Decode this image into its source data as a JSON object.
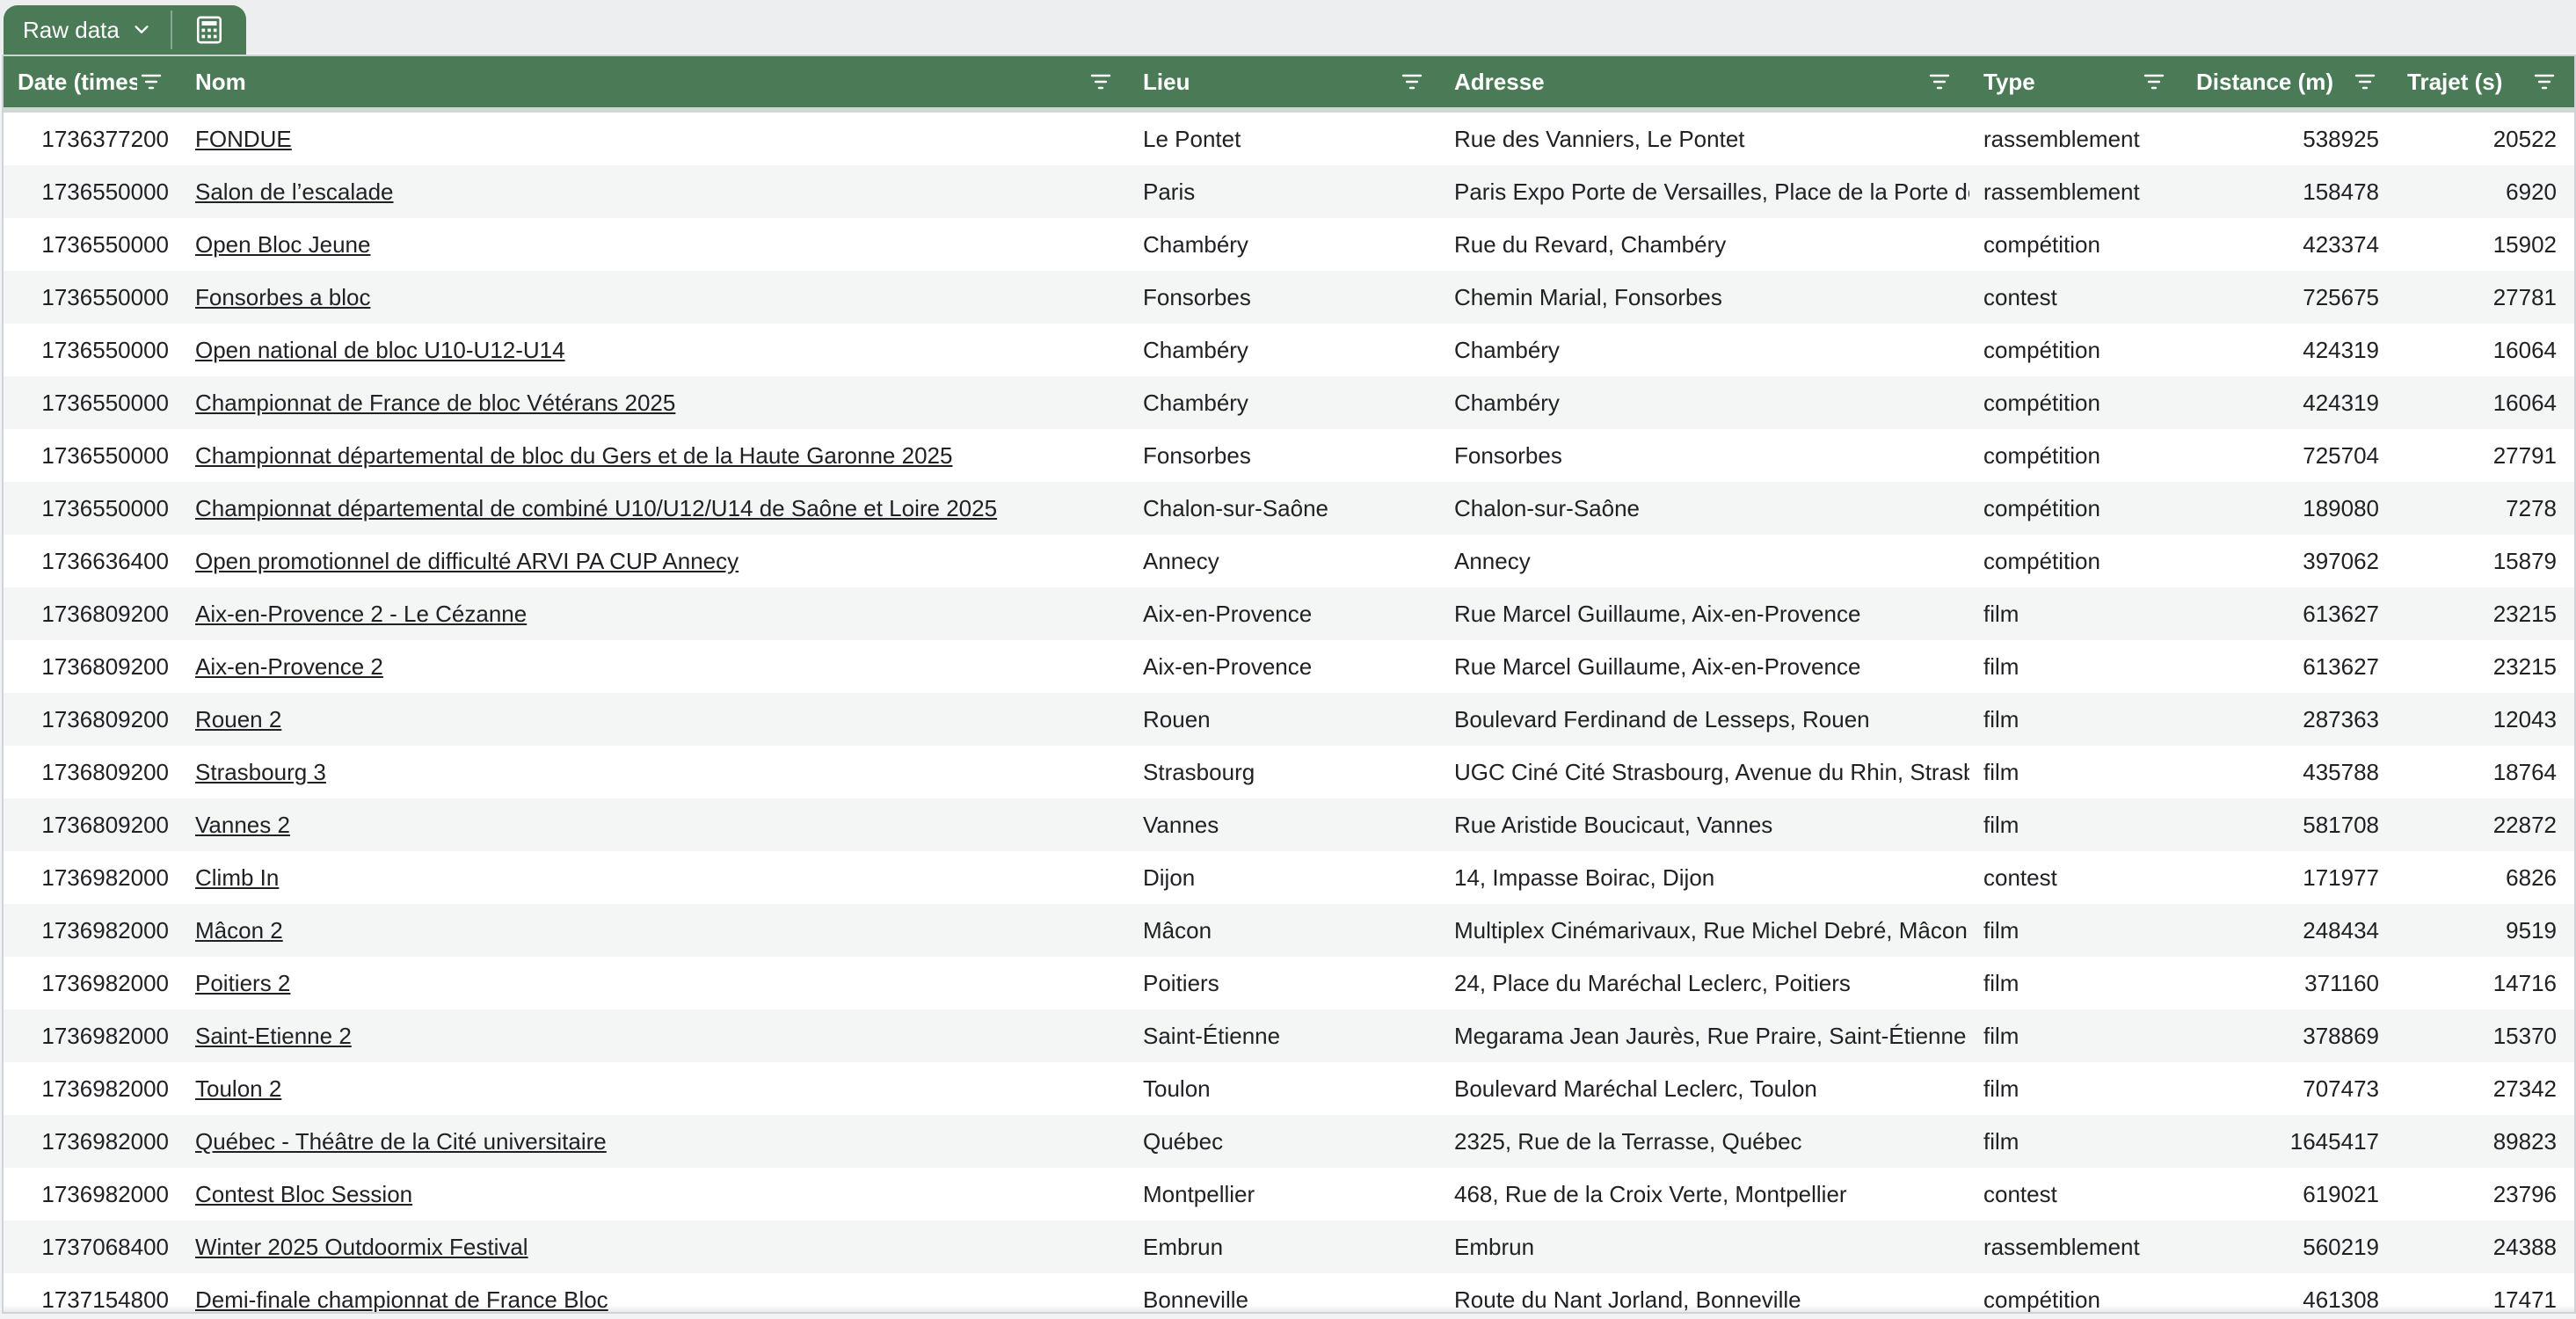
{
  "tabs": {
    "raw_label": "Raw data",
    "raw_icon": "chevron-down-icon",
    "calc_icon": "calculator-icon"
  },
  "columns": [
    {
      "label": "Date (timestamp)"
    },
    {
      "label": "Nom"
    },
    {
      "label": "Lieu"
    },
    {
      "label": "Adresse"
    },
    {
      "label": "Type"
    },
    {
      "label": "Distance (m)"
    },
    {
      "label": "Trajet (s)"
    }
  ],
  "rows": [
    {
      "date": "1736377200",
      "nom": "FONDUE",
      "lieu": "Le Pontet",
      "adresse": "Rue des Vanniers, Le Pontet",
      "type": "rassemblement",
      "distance": "538925",
      "trajet": "20522"
    },
    {
      "date": "1736550000",
      "nom": "Salon de l’escalade",
      "lieu": "Paris",
      "adresse": "Paris Expo Porte de Versailles, Place de la Porte de Versailles, Paris",
      "type": "rassemblement",
      "distance": "158478",
      "trajet": "6920"
    },
    {
      "date": "1736550000",
      "nom": "Open Bloc Jeune",
      "lieu": "Chambéry",
      "adresse": "Rue du Revard, Chambéry",
      "type": "compétition",
      "distance": "423374",
      "trajet": "15902"
    },
    {
      "date": "1736550000",
      "nom": "Fonsorbes a bloc",
      "lieu": "Fonsorbes",
      "adresse": "Chemin Marial, Fonsorbes",
      "type": "contest",
      "distance": "725675",
      "trajet": "27781"
    },
    {
      "date": "1736550000",
      "nom": "Open national de bloc U10-U12-U14",
      "lieu": "Chambéry",
      "adresse": "Chambéry",
      "type": "compétition",
      "distance": "424319",
      "trajet": "16064"
    },
    {
      "date": "1736550000",
      "nom": "Championnat de France de bloc Vétérans 2025",
      "lieu": "Chambéry",
      "adresse": "Chambéry",
      "type": "compétition",
      "distance": "424319",
      "trajet": "16064"
    },
    {
      "date": "1736550000",
      "nom": "Championnat départemental de bloc du Gers et de la Haute Garonne 2025",
      "lieu": "Fonsorbes",
      "adresse": "Fonsorbes",
      "type": "compétition",
      "distance": "725704",
      "trajet": "27791"
    },
    {
      "date": "1736550000",
      "nom": "Championnat départemental de combiné U10/U12/U14 de Saône et Loire 2025",
      "lieu": "Chalon-sur-Saône",
      "adresse": "Chalon-sur-Saône",
      "type": "compétition",
      "distance": "189080",
      "trajet": "7278"
    },
    {
      "date": "1736636400",
      "nom": "Open promotionnel de difficulté ARVI PA CUP Annecy",
      "lieu": "Annecy",
      "adresse": "Annecy",
      "type": "compétition",
      "distance": "397062",
      "trajet": "15879"
    },
    {
      "date": "1736809200",
      "nom": "Aix-en-Provence 2 - Le Cézanne",
      "lieu": "Aix-en-Provence",
      "adresse": "Rue Marcel Guillaume, Aix-en-Provence",
      "type": "film",
      "distance": "613627",
      "trajet": "23215"
    },
    {
      "date": "1736809200",
      "nom": "Aix-en-Provence 2",
      "lieu": "Aix-en-Provence",
      "adresse": "Rue Marcel Guillaume, Aix-en-Provence",
      "type": "film",
      "distance": "613627",
      "trajet": "23215"
    },
    {
      "date": "1736809200",
      "nom": "Rouen 2",
      "lieu": "Rouen",
      "adresse": "Boulevard Ferdinand de Lesseps, Rouen",
      "type": "film",
      "distance": "287363",
      "trajet": "12043"
    },
    {
      "date": "1736809200",
      "nom": "Strasbourg 3",
      "lieu": "Strasbourg",
      "adresse": "UGC Ciné Cité Strasbourg, Avenue du Rhin, Strasbourg",
      "type": "film",
      "distance": "435788",
      "trajet": "18764"
    },
    {
      "date": "1736809200",
      "nom": "Vannes 2",
      "lieu": "Vannes",
      "adresse": "Rue Aristide Boucicaut, Vannes",
      "type": "film",
      "distance": "581708",
      "trajet": "22872"
    },
    {
      "date": "1736982000",
      "nom": "Climb In",
      "lieu": "Dijon",
      "adresse": "14, Impasse Boirac, Dijon",
      "type": "contest",
      "distance": "171977",
      "trajet": "6826"
    },
    {
      "date": "1736982000",
      "nom": "Mâcon 2",
      "lieu": "Mâcon",
      "adresse": "Multiplex Cinémarivaux, Rue Michel Debré, Mâcon",
      "type": "film",
      "distance": "248434",
      "trajet": "9519"
    },
    {
      "date": "1736982000",
      "nom": "Poitiers 2",
      "lieu": "Poitiers",
      "adresse": "24, Place du Maréchal Leclerc, Poitiers",
      "type": "film",
      "distance": "371160",
      "trajet": "14716"
    },
    {
      "date": "1736982000",
      "nom": "Saint-Etienne 2",
      "lieu": "Saint-Étienne",
      "adresse": "Megarama Jean Jaurès, Rue Praire, Saint-Étienne",
      "type": "film",
      "distance": "378869",
      "trajet": "15370"
    },
    {
      "date": "1736982000",
      "nom": "Toulon 2",
      "lieu": "Toulon",
      "adresse": "Boulevard Maréchal Leclerc, Toulon",
      "type": "film",
      "distance": "707473",
      "trajet": "27342"
    },
    {
      "date": "1736982000",
      "nom": "Québec - Théâtre de la Cité universitaire",
      "lieu": "Québec",
      "adresse": "2325, Rue de la Terrasse, Québec",
      "type": "film",
      "distance": "1645417",
      "trajet": "89823"
    },
    {
      "date": "1736982000",
      "nom": "Contest Bloc Session",
      "lieu": "Montpellier",
      "adresse": "468, Rue de la Croix Verte, Montpellier",
      "type": "contest",
      "distance": "619021",
      "trajet": "23796"
    },
    {
      "date": "1737068400",
      "nom": "Winter 2025 Outdoormix Festival",
      "lieu": "Embrun",
      "adresse": "Embrun",
      "type": "rassemblement",
      "distance": "560219",
      "trajet": "24388"
    },
    {
      "date": "1737154800",
      "nom": "Demi-finale championnat de France Bloc",
      "lieu": "Bonneville",
      "adresse": "Route du Nant Jorland, Bonneville",
      "type": "compétition",
      "distance": "461308",
      "trajet": "17471"
    }
  ]
}
